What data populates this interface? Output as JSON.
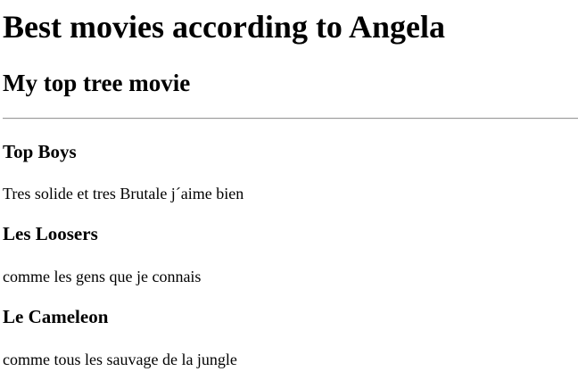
{
  "page": {
    "title": "Best movies according to Angela",
    "subtitle": "My top tree movie"
  },
  "movies": [
    {
      "title": "Top Boys",
      "description": "Tres solide et tres Brutale j´aime bien"
    },
    {
      "title": "Les Loosers",
      "description": "comme les gens que je connais"
    },
    {
      "title": "Le Cameleon",
      "description": "comme tous les sauvage de la jungle"
    }
  ]
}
